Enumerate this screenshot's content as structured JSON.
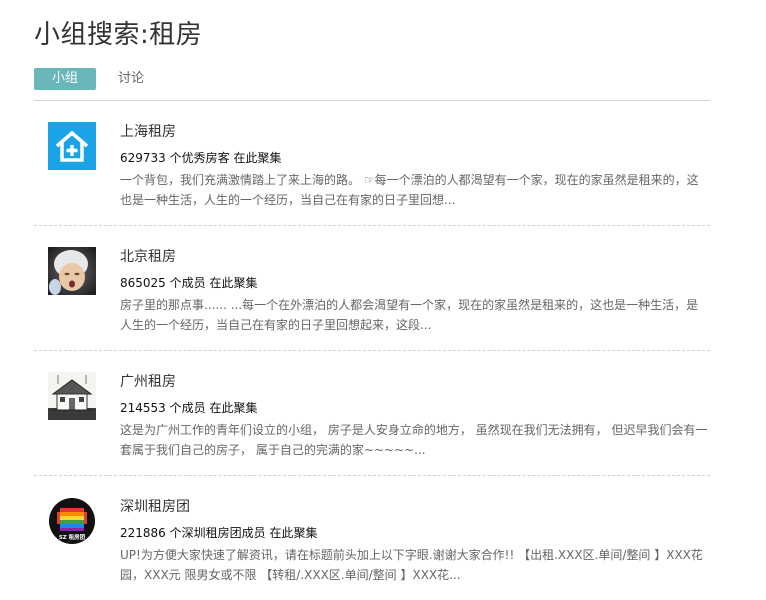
{
  "page": {
    "title": "小组搜索:租房"
  },
  "tabs": [
    {
      "label": "小组",
      "active": true
    },
    {
      "label": "讨论",
      "active": false
    }
  ],
  "groups": [
    {
      "name": "上海租房",
      "stats": "629733 个优秀房客 在此聚集",
      "description": "一个背包，我们充满激情踏上了来上海的路。 ☞每一个漂泊的人都渴望有一个家，现在的家虽然是租来的，这也是一种生活，人生的一个经历，当自己在有家的日子里回想...",
      "avatar_icon": "house-plus-icon"
    },
    {
      "name": "北京租房",
      "stats": "865025 个成员 在此聚集",
      "description": "房子里的那点事...... ...每一个在外漂泊的人都会渴望有一个家，现在的家虽然是租来的，这也是一种生活，是人生的一个经历，当自己在有家的日子里回想起来，这段...",
      "avatar_icon": "baby-photo-icon"
    },
    {
      "name": "广州租房",
      "stats": "214553 个成员 在此聚集",
      "description": "这是为广州工作的青年们设立的小组， 房子是人安身立命的地方， 虽然现在我们无法拥有， 但迟早我们会有一套属于我们自己的房子， 属于自己的完满的家~~~~~...",
      "avatar_icon": "house-sketch-icon"
    },
    {
      "name": "深圳租房团",
      "stats": "221886 个深圳租房团成员 在此聚集",
      "description": "UP!为方便大家快速了解资讯，请在标题前头加上以下字眼.谢谢大家合作!! 【出租.XXX区.单间/整间 】XXX花园，XXX元 限男女或不限 【转租/.XXX区.单间/整间 】XXX花...",
      "avatar_icon": "sz-rainbow-logo-icon",
      "avatar_text": "SZ 租房团"
    }
  ],
  "colors": {
    "accent": "#69b6bb",
    "shanghai_avatar_bg": "#1aa3e6"
  }
}
